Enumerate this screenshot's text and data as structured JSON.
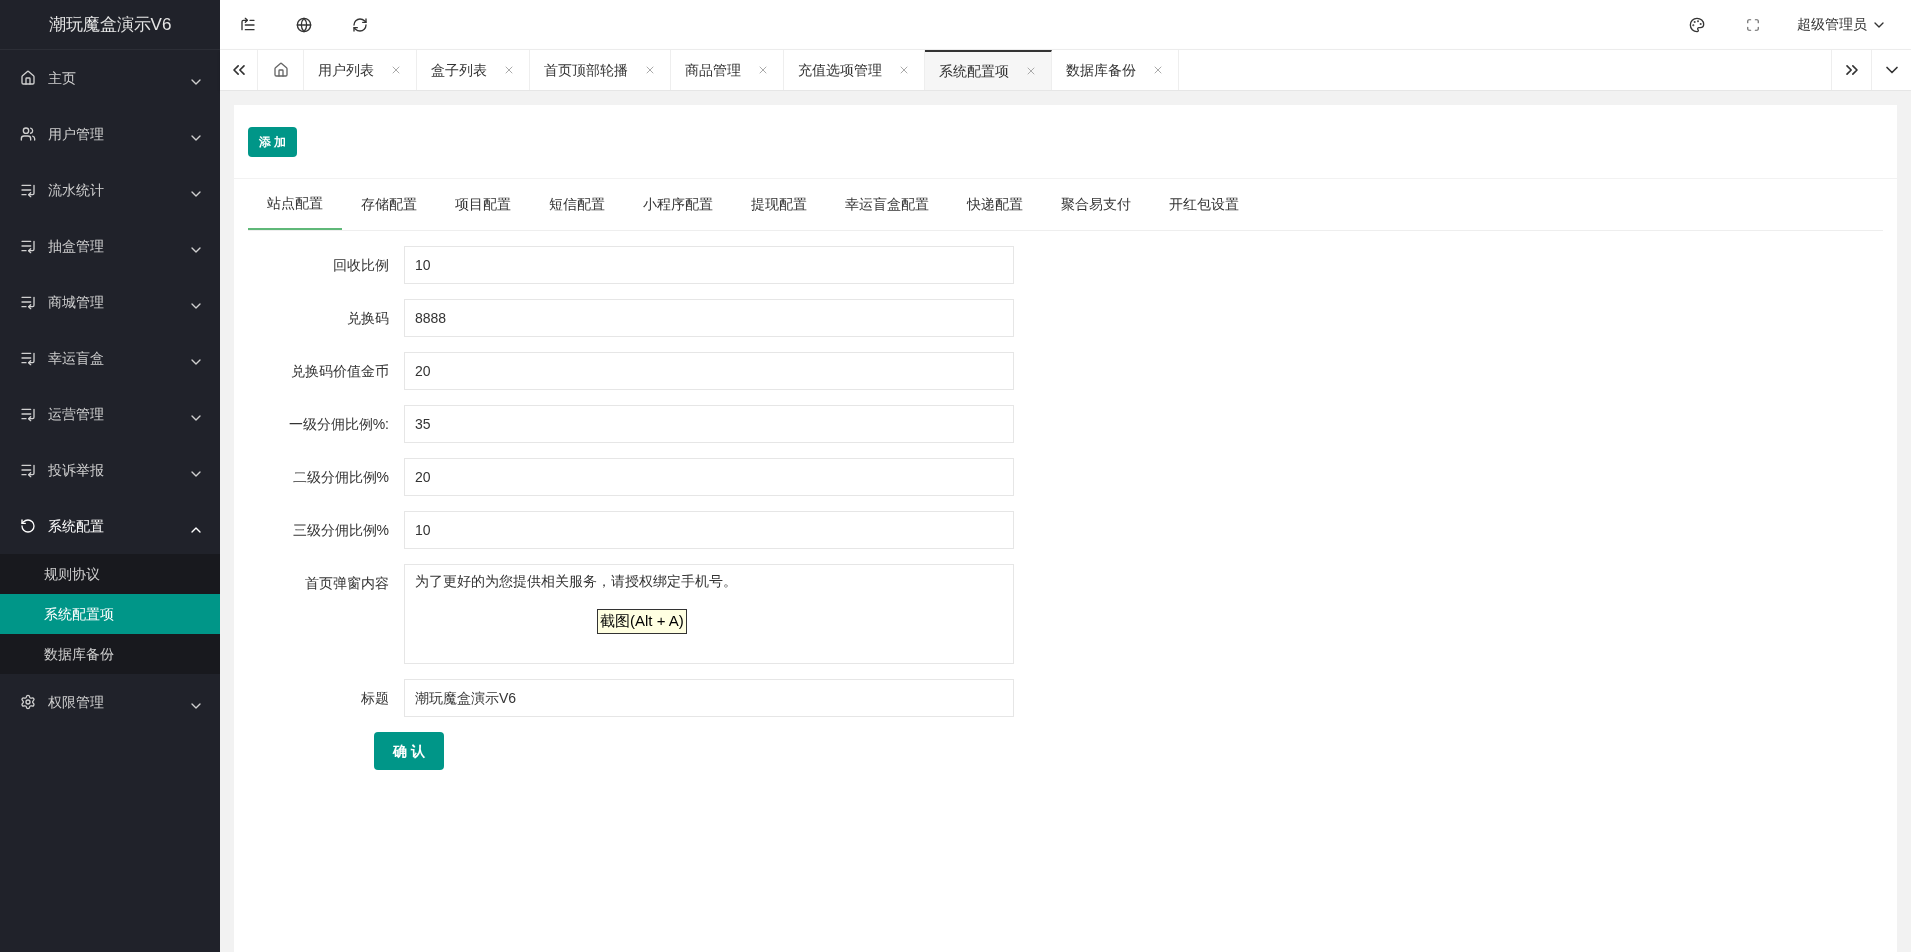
{
  "app_title": "潮玩魔盒演示V6",
  "sidebar": {
    "items": [
      {
        "label": "主页",
        "kind": "home",
        "expanded": false
      },
      {
        "label": "用户管理",
        "kind": "users",
        "expanded": false
      },
      {
        "label": "流水统计",
        "kind": "list",
        "expanded": false
      },
      {
        "label": "抽盒管理",
        "kind": "list",
        "expanded": false
      },
      {
        "label": "商城管理",
        "kind": "list",
        "expanded": false
      },
      {
        "label": "幸运盲盒",
        "kind": "list",
        "expanded": false
      },
      {
        "label": "运营管理",
        "kind": "list",
        "expanded": false
      },
      {
        "label": "投诉举报",
        "kind": "list",
        "expanded": false
      },
      {
        "label": "系统配置",
        "kind": "cycle",
        "expanded": true,
        "children": [
          {
            "label": "规则协议",
            "selected": false
          },
          {
            "label": "系统配置项",
            "selected": true
          },
          {
            "label": "数据库备份",
            "selected": false
          }
        ]
      },
      {
        "label": "权限管理",
        "kind": "gear",
        "expanded": false
      }
    ]
  },
  "header": {
    "user": "超级管理员"
  },
  "page_tabs": [
    {
      "label": "用户列表",
      "selected": false
    },
    {
      "label": "盒子列表",
      "selected": false
    },
    {
      "label": "首页顶部轮播",
      "selected": false
    },
    {
      "label": "商品管理",
      "selected": false
    },
    {
      "label": "充值选项管理",
      "selected": false
    },
    {
      "label": "系统配置项",
      "selected": true
    },
    {
      "label": "数据库备份",
      "selected": false
    }
  ],
  "add_button": "添 加",
  "config_tabs": [
    {
      "label": "站点配置",
      "selected": true
    },
    {
      "label": "存储配置",
      "selected": false
    },
    {
      "label": "项目配置",
      "selected": false
    },
    {
      "label": "短信配置",
      "selected": false
    },
    {
      "label": "小程序配置",
      "selected": false
    },
    {
      "label": "提现配置",
      "selected": false
    },
    {
      "label": "幸运盲盒配置",
      "selected": false
    },
    {
      "label": "快递配置",
      "selected": false
    },
    {
      "label": "聚合易支付",
      "selected": false
    },
    {
      "label": "开红包设置",
      "selected": false
    }
  ],
  "form": [
    {
      "kind": "input",
      "label": "回收比例",
      "value": "10"
    },
    {
      "kind": "input",
      "label": "兑换码",
      "value": "8888"
    },
    {
      "kind": "input",
      "label": "兑换码价值金币",
      "value": "20"
    },
    {
      "kind": "input",
      "label": "一级分佣比例%:",
      "value": "35"
    },
    {
      "kind": "input",
      "label": "二级分佣比例%",
      "value": "20"
    },
    {
      "kind": "input",
      "label": "三级分佣比例%",
      "value": "10"
    },
    {
      "kind": "textarea",
      "label": "首页弹窗内容",
      "value": "为了更好的为您提供相关服务，请授权绑定手机号。"
    },
    {
      "kind": "input",
      "label": "标题",
      "value": "潮玩魔盒演示V6"
    }
  ],
  "tooltip": "截图(Alt + A)",
  "submit_button": "确 认"
}
